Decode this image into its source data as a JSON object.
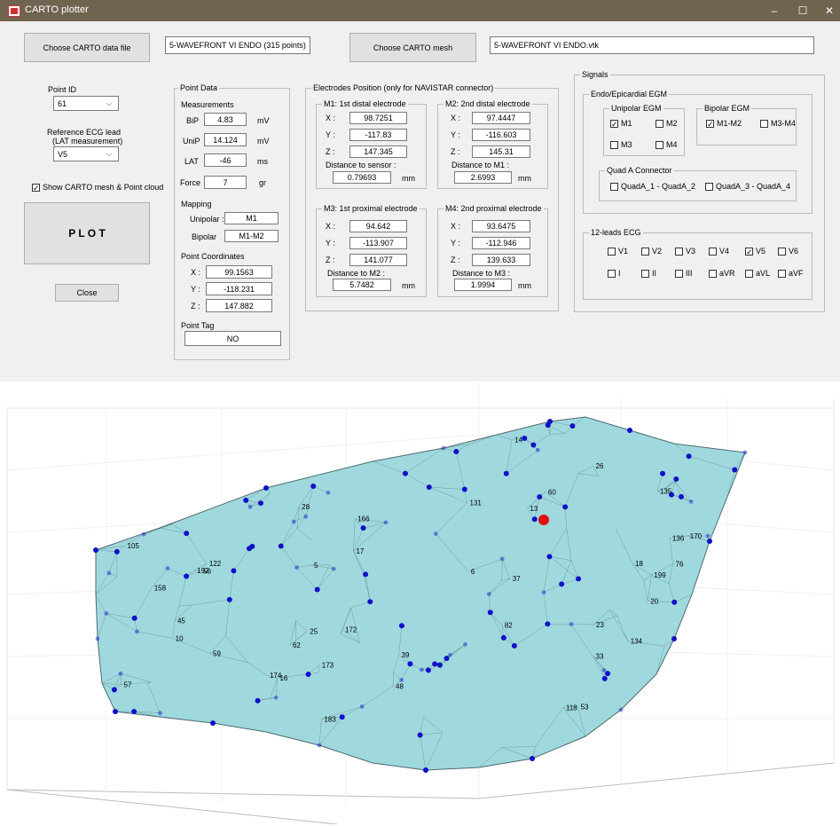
{
  "window": {
    "title": "CARTO plotter",
    "minimize": "–",
    "maximize": "☐",
    "close": "✕"
  },
  "top": {
    "choose_data_btn": "Choose CARTO data file",
    "data_file": "5-WAVEFRONT VI ENDO  (315 points)",
    "choose_mesh_btn": "Choose CARTO mesh",
    "mesh_file": "5-WAVEFRONT VI ENDO.vtk"
  },
  "left": {
    "point_id_label": "Point ID",
    "point_id_value": "61",
    "ref_ecg_label1": "Reference ECG lead",
    "ref_ecg_label2": "(LAT measurement)",
    "ref_ecg_value": "V5",
    "show_mesh_label": "Show CARTO mesh & Point cloud",
    "show_mesh_checked": "✓",
    "plot_btn": "P L O T",
    "close_btn": "Close"
  },
  "point_data": {
    "title": "Point Data",
    "measurements": "Measurements",
    "bip_label": "BiP",
    "bip_value": "4.83",
    "bip_unit": "mV",
    "unip_label": "UniP",
    "unip_value": "14.124",
    "unip_unit": "mV",
    "lat_label": "LAT",
    "lat_value": "-46",
    "lat_unit": "ms",
    "force_label": "Force",
    "force_value": "7",
    "force_unit": "gr",
    "mapping": "Mapping",
    "unipolar_label": "Unipolar :",
    "unipolar_value": "M1",
    "bipolar_label": "Bipolar",
    "bipolar_value": "M1-M2",
    "coords_title": "Point Coordinates",
    "x_label": "X :",
    "x_value": "99.1563",
    "y_label": "Y :",
    "y_value": "-118.231",
    "z_label": "Z :",
    "z_value": "147.882",
    "tag_title": "Point Tag",
    "tag_value": "NO"
  },
  "electrodes": {
    "title": "Electrodes Position (only for NAVISTAR connector)",
    "m1": {
      "title": "M1: 1st distal electrode",
      "x": "98.7251",
      "y": "-117.83",
      "z": "147.345",
      "dist_label": "Distance to sensor :",
      "dist": "0.79693",
      "unit": "mm"
    },
    "m2": {
      "title": "M2: 2nd distal electrode",
      "x": "97.4447",
      "y": "-116.603",
      "z": "145.31",
      "dist_label": "Distance to M1 :",
      "dist": "2.6993",
      "unit": "mm"
    },
    "m3": {
      "title": "M3: 1st proximal electrode",
      "x": "94.642",
      "y": "-113.907",
      "z": "141.077",
      "dist_label": "Distance to M2 :",
      "dist": "5.7482",
      "unit": "mm"
    },
    "m4": {
      "title": "M4: 2nd proximal electrode",
      "x": "93.6475",
      "y": "-112.946",
      "z": "139.633",
      "dist_label": "Distance to M3 :",
      "dist": "1.9994",
      "unit": "mm"
    },
    "x_label": "X :",
    "y_label": "Y :",
    "z_label": "Z :"
  },
  "signals": {
    "title": "Signals",
    "endo_title": "Endo/Epicardial EGM",
    "unipolar_title": "Unipolar EGM",
    "bipolar_title": "Bipolar EGM",
    "m1": "M1",
    "m2": "M2",
    "m3": "M3",
    "m4": "M4",
    "m1m2": "M1-M2",
    "m3m4": "M3-M4",
    "quad_title": "Quad A Connector",
    "quad1": "QuadA_1 - QuadA_2",
    "quad2": "QuadA_3 - QuadA_4",
    "ecg_title": "12-leads ECG",
    "leads": [
      "V1",
      "V2",
      "V3",
      "V4",
      "V5",
      "V6",
      "I",
      "II",
      "III",
      "aVR",
      "aVL",
      "aVF"
    ],
    "check": "✓"
  },
  "plot": {
    "labels": [
      "23",
      "135",
      "170",
      "172",
      "59",
      "192",
      "166",
      "60",
      "62",
      "37",
      "5",
      "173",
      "134",
      "33",
      "174",
      "136",
      "131",
      "76",
      "28",
      "16",
      "118",
      "105",
      "122",
      "183",
      "14",
      "18",
      "20",
      "82",
      "48",
      "26",
      "53",
      "39",
      "56",
      "45",
      "10",
      "6",
      "57",
      "25",
      "17",
      "13",
      "199",
      "158"
    ],
    "colors": {
      "mesh": "#9fd9de",
      "edge": "#4d6a70",
      "point": "#1010c8",
      "selected": "#e01010"
    }
  }
}
